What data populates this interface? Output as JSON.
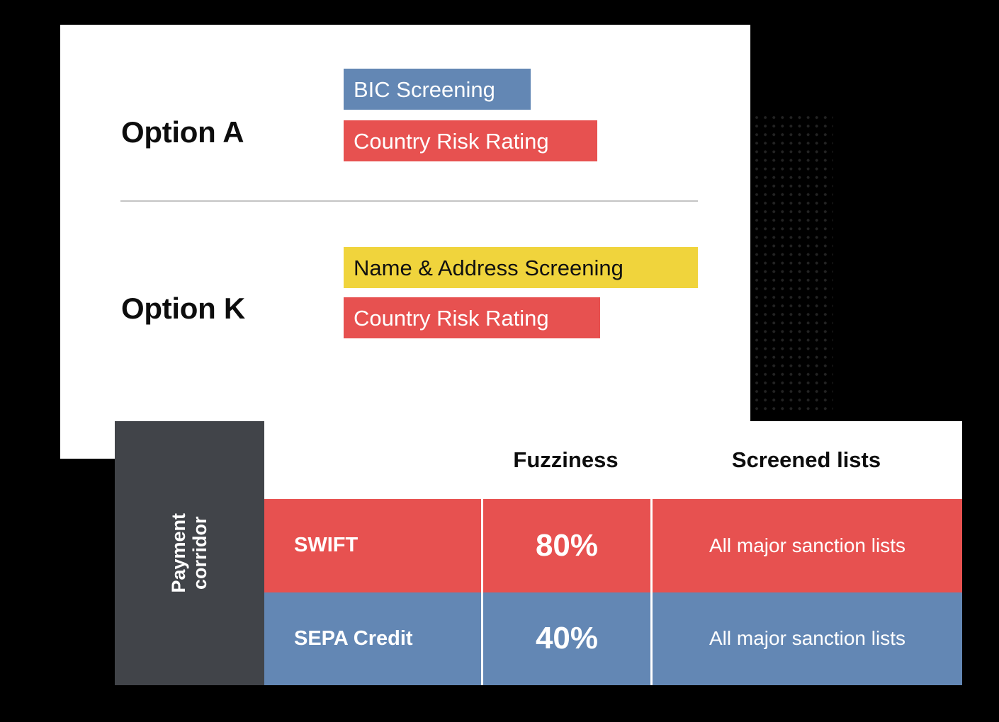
{
  "card": {
    "options": [
      {
        "label": "Option A",
        "bars": [
          {
            "text": "BIC Screening",
            "color": "#6387b4",
            "text_color": "#ffffff"
          },
          {
            "text": "Country Risk Rating",
            "color": "#e75150",
            "text_color": "#ffffff"
          }
        ]
      },
      {
        "label": "Option K",
        "bars": [
          {
            "text": "Name & Address Screening",
            "color": "#f0d43c",
            "text_color": "#111111"
          },
          {
            "text": "Country Risk Rating",
            "color": "#e75150",
            "text_color": "#ffffff"
          }
        ]
      }
    ]
  },
  "table": {
    "corridor_label_line1": "Payment",
    "corridor_label_line2": "corridor",
    "headers": [
      "",
      "Fuzziness",
      "Screened lists"
    ],
    "rows": [
      {
        "name": "SWIFT",
        "fuzziness": "80%",
        "lists": "All major sanction lists",
        "color": "#e75150"
      },
      {
        "name": "SEPA Credit",
        "fuzziness": "40%",
        "lists": "All major sanction lists",
        "color": "#6387b4"
      }
    ]
  },
  "colors": {
    "background": "#000000",
    "card": "#ffffff",
    "corridor_panel": "#414449",
    "blue": "#6387b4",
    "red": "#e75150",
    "yellow": "#f0d43c",
    "divider": "#c4c4c4",
    "dots": "#232323"
  }
}
